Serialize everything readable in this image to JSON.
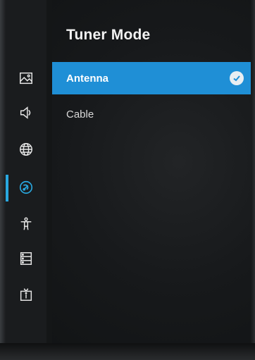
{
  "menu": {
    "title": "Tuner Mode",
    "options": [
      {
        "label": "Antenna",
        "selected": true
      },
      {
        "label": "Cable",
        "selected": false
      }
    ]
  },
  "sidebar": {
    "icons": [
      "picture-icon",
      "sound-icon",
      "network-icon",
      "channels-icon",
      "accessibility-icon",
      "system-icon",
      "tv-info-icon"
    ],
    "active_icon": "channels-icon"
  },
  "colors": {
    "accent": "#29a8e0",
    "selected_bg": "#1f8fd6"
  }
}
